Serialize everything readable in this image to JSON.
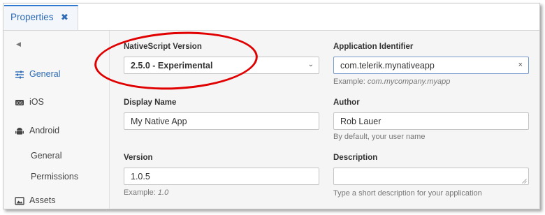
{
  "tab": {
    "title": "Properties",
    "close": "✖"
  },
  "sidebar": {
    "collapse": "◀",
    "items": [
      {
        "label": "General",
        "icon": "sliders-icon",
        "active": true
      },
      {
        "label": "iOS",
        "icon": "ios-icon"
      },
      {
        "label": "Android",
        "icon": "android-icon"
      },
      {
        "label": "Assets",
        "icon": "image-icon"
      }
    ],
    "android_sub": [
      "General",
      "Permissions"
    ]
  },
  "form": {
    "ns_version": {
      "label": "NativeScript Version",
      "value": "2.5.0 - Experimental"
    },
    "app_id": {
      "label": "Application Identifier",
      "value": "com.telerik.mynativeapp",
      "hint_prefix": "Example: ",
      "hint_example": "com.mycompany.myapp"
    },
    "display_name": {
      "label": "Display Name",
      "value": "My Native App"
    },
    "author": {
      "label": "Author",
      "value": "Rob Lauer",
      "hint": "By default, your user name"
    },
    "version": {
      "label": "Version",
      "value": "1.0.5",
      "hint_prefix": "Example: ",
      "hint_example": "1.0"
    },
    "description": {
      "label": "Description",
      "value": "",
      "hint": "Type a short description for your application"
    }
  },
  "colors": {
    "accent": "#2f7ad0",
    "annotation": "#e00000"
  }
}
